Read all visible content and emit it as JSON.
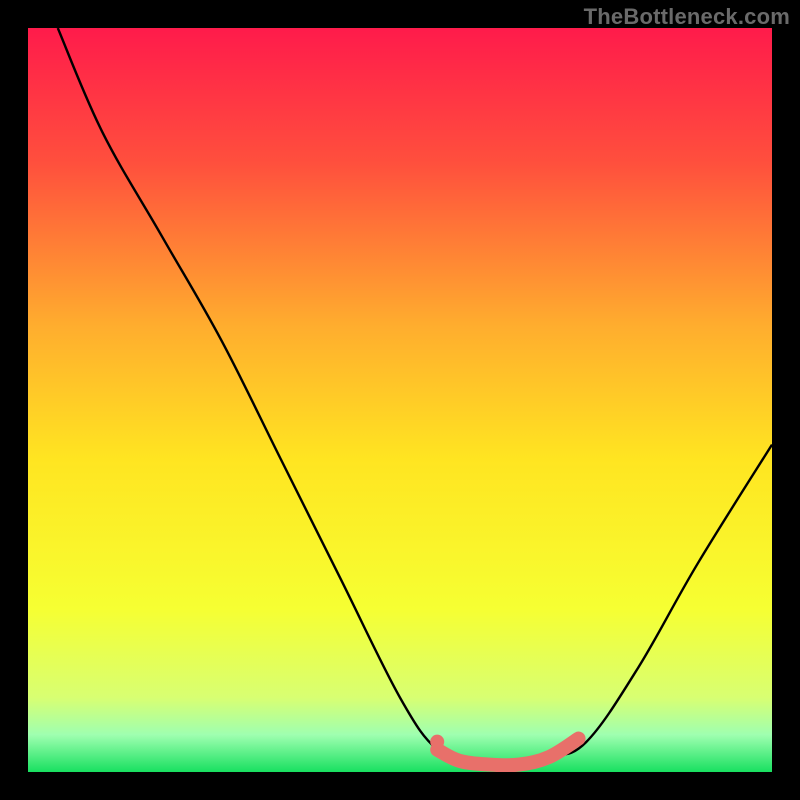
{
  "watermark": "TheBottleneck.com",
  "chart_data": {
    "type": "line",
    "title": "",
    "xlabel": "",
    "ylabel": "",
    "xlim": [
      0,
      100
    ],
    "ylim": [
      0,
      100
    ],
    "gradient_stops": [
      {
        "offset": 0,
        "color": "#ff1b4b"
      },
      {
        "offset": 0.18,
        "color": "#ff4f3d"
      },
      {
        "offset": 0.4,
        "color": "#ffad2e"
      },
      {
        "offset": 0.58,
        "color": "#ffe521"
      },
      {
        "offset": 0.78,
        "color": "#f6ff32"
      },
      {
        "offset": 0.9,
        "color": "#d8ff72"
      },
      {
        "offset": 0.95,
        "color": "#9fffb0"
      },
      {
        "offset": 1.0,
        "color": "#18e060"
      }
    ],
    "series": [
      {
        "name": "bottleneck-curve",
        "type": "line",
        "color": "#000000",
        "points": [
          {
            "x": 4,
            "y": 100
          },
          {
            "x": 10,
            "y": 86
          },
          {
            "x": 18,
            "y": 72
          },
          {
            "x": 26,
            "y": 58
          },
          {
            "x": 34,
            "y": 42
          },
          {
            "x": 42,
            "y": 26
          },
          {
            "x": 50,
            "y": 10
          },
          {
            "x": 55,
            "y": 3
          },
          {
            "x": 60,
            "y": 1
          },
          {
            "x": 65,
            "y": 1
          },
          {
            "x": 70,
            "y": 2
          },
          {
            "x": 75,
            "y": 4
          },
          {
            "x": 82,
            "y": 14
          },
          {
            "x": 90,
            "y": 28
          },
          {
            "x": 100,
            "y": 44
          }
        ]
      },
      {
        "name": "optimal-zone",
        "type": "line",
        "color": "#e8706a",
        "points": [
          {
            "x": 55,
            "y": 3
          },
          {
            "x": 58,
            "y": 1.5
          },
          {
            "x": 62,
            "y": 1
          },
          {
            "x": 66,
            "y": 1
          },
          {
            "x": 70,
            "y": 2
          },
          {
            "x": 74,
            "y": 4.5
          }
        ]
      }
    ]
  }
}
